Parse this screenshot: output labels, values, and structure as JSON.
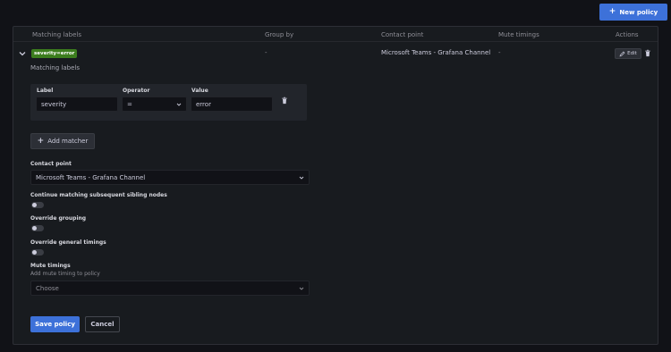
{
  "header": {
    "new_policy_label": "New policy"
  },
  "table": {
    "columns": [
      "Matching labels",
      "Group by",
      "Contact point",
      "Mute timings",
      "Actions"
    ],
    "row": {
      "badge": "severity=error",
      "group_by": "-",
      "contact_point": "Microsoft Teams - Grafana Channel",
      "mute_timings": "-",
      "edit_label": "Edit"
    }
  },
  "form": {
    "matching_labels_title": "Matching labels",
    "matcher": {
      "label_header": "Label",
      "operator_header": "Operator",
      "value_header": "Value",
      "label_value": "severity",
      "operator_value": "=",
      "value_value": "error"
    },
    "add_matcher_label": "Add matcher",
    "contact_point_label": "Contact point",
    "contact_point_value": "Microsoft Teams - Grafana Channel",
    "continue_label": "Continue matching subsequent sibling nodes",
    "override_grouping_label": "Override grouping",
    "override_timings_label": "Override general timings",
    "mute_timings_label": "Mute timings",
    "mute_timings_sub": "Add mute timing to policy",
    "mute_timings_placeholder": "Choose",
    "save_label": "Save policy",
    "cancel_label": "Cancel"
  },
  "colors": {
    "accent": "#3d71d9",
    "badge_bg": "#3c7d1e",
    "background": "#111217",
    "panel": "#181b1f"
  }
}
